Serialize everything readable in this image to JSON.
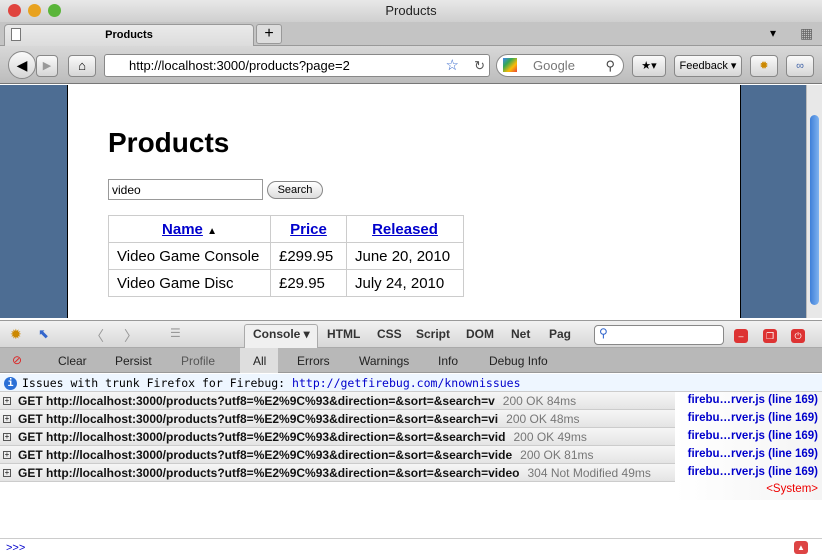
{
  "window": {
    "title": "Products"
  },
  "tabs": [
    {
      "label": "Products"
    }
  ],
  "new_tab_label": "+",
  "nav": {
    "url": "http://localhost:3000/products?page=2",
    "search_placeholder": "Google",
    "feedback_label": "Feedback ▾"
  },
  "page": {
    "heading": "Products",
    "search_value": "video",
    "search_button": "Search",
    "columns": [
      "Name",
      "Price",
      "Released"
    ],
    "sort_indicator": "▲",
    "rows": [
      [
        "Video Game Console",
        "£299.95",
        "June 20, 2010"
      ],
      [
        "Video Game Disc",
        "£29.95",
        "July 24, 2010"
      ]
    ]
  },
  "firebug": {
    "tabs": [
      "Console ▾",
      "HTML",
      "CSS",
      "Script",
      "DOM",
      "Net",
      "Pag"
    ],
    "subtoolbar": [
      "Clear",
      "Persist",
      "Profile",
      "All",
      "Errors",
      "Warnings",
      "Info",
      "Debug Info"
    ],
    "info_text": "Issues with trunk Firefox for Firebug:",
    "info_link": "http://getfirebug.com/knownissues",
    "requests": [
      {
        "text": "GET http://localhost:3000/products?utf8=%E2%9C%93&direction=&sort=&search=v",
        "status": "200 OK 84ms",
        "source": "firebu…rver.js (line 169)"
      },
      {
        "text": "GET http://localhost:3000/products?utf8=%E2%9C%93&direction=&sort=&search=vi",
        "status": "200 OK 48ms",
        "source": "firebu…rver.js (line 169)"
      },
      {
        "text": "GET http://localhost:3000/products?utf8=%E2%9C%93&direction=&sort=&search=vid",
        "status": "200 OK 49ms",
        "source": "firebu…rver.js (line 169)"
      },
      {
        "text": "GET http://localhost:3000/products?utf8=%E2%9C%93&direction=&sort=&search=vide",
        "status": "200 OK 81ms",
        "source": "firebu…rver.js (line 169)"
      },
      {
        "text": "GET http://localhost:3000/products?utf8=%E2%9C%93&direction=&sort=&search=video",
        "status": "304 Not Modified 49ms",
        "source": "firebu…rver.js (line 169)"
      }
    ],
    "system_label": "<System>",
    "command_prompt": ">>>"
  }
}
